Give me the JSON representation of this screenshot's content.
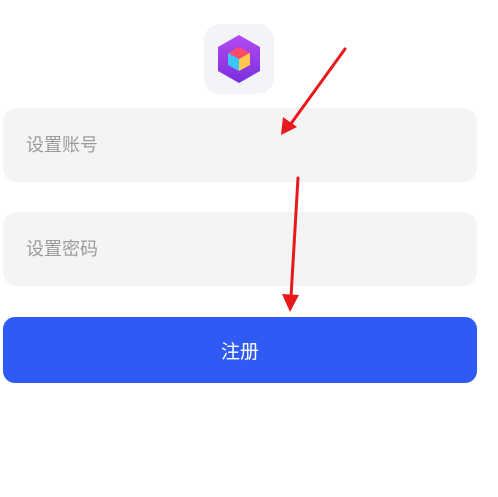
{
  "logo": {
    "icon": "cube-icon",
    "colors": {
      "tile": "#f3f4f8",
      "hex_top": "#b34af0",
      "hex_bottom": "#7a2fe0",
      "cube_top": "#ff4a6a",
      "cube_left": "#3cc6ff",
      "cube_right": "#ffc84a"
    }
  },
  "form": {
    "account_placeholder": "设置账号",
    "password_placeholder": "设置密码",
    "submit_label": "注册"
  },
  "colors": {
    "primary": "#2f5af3",
    "field_bg": "#f4f4f4",
    "annotation_arrow": "#e8191c"
  }
}
